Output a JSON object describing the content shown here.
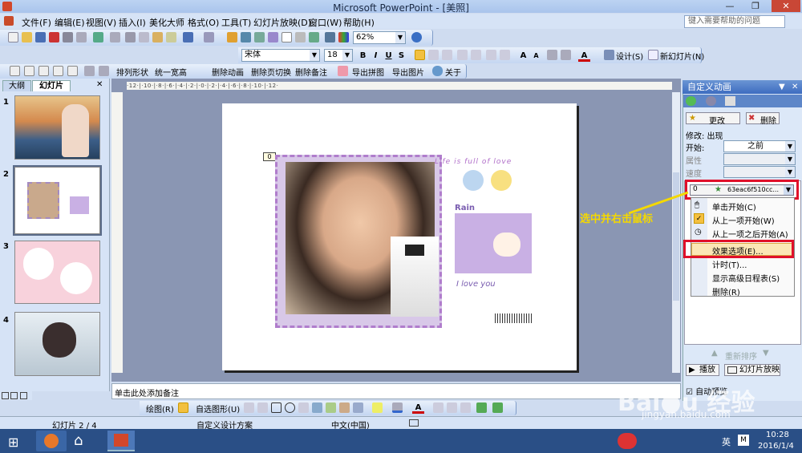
{
  "window": {
    "title": "Microsoft PowerPoint - [美照]",
    "help_placeholder": "键入需要帮助的问题"
  },
  "menu": [
    "文件(F)",
    "编辑(E)",
    "视图(V)",
    "插入(I)",
    "美化大师",
    "格式(O)",
    "工具(T)",
    "幻灯片放映(D)",
    "窗口(W)",
    "帮助(H)"
  ],
  "toolbar1": {
    "zoom": "62%"
  },
  "toolbar2": {
    "font": "宋体",
    "size": "18",
    "design": "设计(S)",
    "new_slide": "新幻灯片(N)"
  },
  "toolbar3": [
    "排列形状",
    "统一宽高",
    "删除动画",
    "删除页切换",
    "删除备注",
    "导出拼图",
    "导出图片",
    "关于"
  ],
  "left_pane": {
    "tab_outline": "大纲",
    "tab_slides": "幻灯片",
    "slide_numbers": [
      "1",
      "2",
      "3",
      "4"
    ]
  },
  "slide": {
    "tag": "0",
    "title_text": "Life is full of love",
    "rain_text": "Rain",
    "love_text": "I love you"
  },
  "notes_placeholder": "单击此处添加备注",
  "drawbar": {
    "draw": "绘图(R)",
    "autoshape": "自选图形(U)"
  },
  "status": {
    "slide": "幻灯片 2 / 4",
    "design": "自定义设计方案",
    "lang": "中文(中国)"
  },
  "taskpane": {
    "title": "自定义动画",
    "change": "更改",
    "delete": "删除",
    "modify": "修改: 出现",
    "start_label": "开始:",
    "start_value": "之前",
    "property_label": "属性",
    "speed_label": "速度",
    "anim_item_num": "0",
    "anim_item": "63eac6f510cc...",
    "reorder": "重新排序",
    "play": "播放",
    "slideshow": "幻灯片放映",
    "autopreview": "自动预览"
  },
  "context_menu": [
    "单击开始(C)",
    "从上一项开始(W)",
    "从上一项之后开始(A)",
    "效果选项(E)...",
    "计时(T)...",
    "显示高级日程表(S)",
    "删除(R)"
  ],
  "annotation": "选中并右击鼠标",
  "taskbar": {
    "time": "10:28",
    "date": "2016/1/4",
    "ime": "英"
  },
  "watermark": "Baidu 经验 jingyan.baidu.com"
}
